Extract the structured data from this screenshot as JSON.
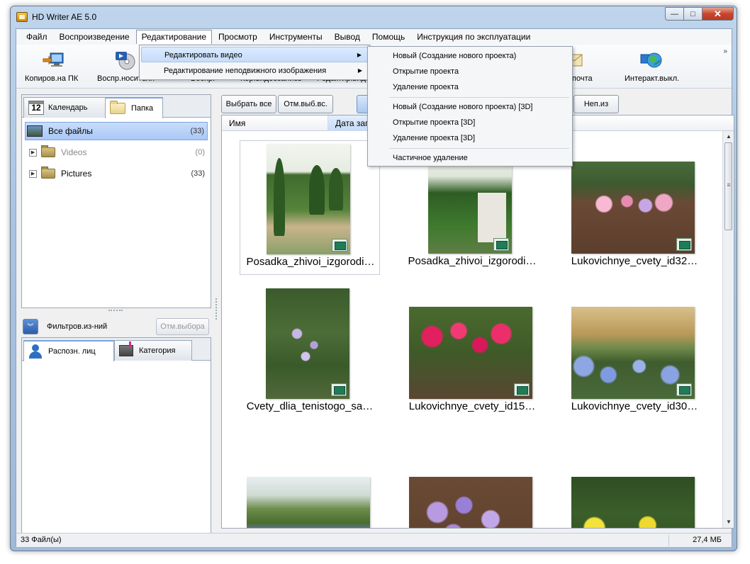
{
  "window": {
    "title": "HD Writer AE 5.0"
  },
  "window_buttons": {
    "minimize": "—",
    "maximize": "□",
    "close": "✕"
  },
  "menu": [
    {
      "label": "Файл"
    },
    {
      "label": "Воспроизведение"
    },
    {
      "label": "Редактирование"
    },
    {
      "label": "Просмотр"
    },
    {
      "label": "Инструменты"
    },
    {
      "label": "Вывод"
    },
    {
      "label": "Помощь"
    },
    {
      "label": "Инструкция по эксплуатации"
    }
  ],
  "toolbar": {
    "items": [
      {
        "label": "Копиров.на ПК",
        "icon": "copy-to-pc-icon"
      },
      {
        "label": "Воспр.носителя",
        "icon": "media-play-icon"
      },
      {
        "label": "Воспр.",
        "icon": "play-icon"
      },
      {
        "label": "Кор.видеозапись",
        "icon": "video-clip-icon"
      },
      {
        "label": "Редактир.виде",
        "icon": "video-edit-icon"
      },
      {
        "label": "почта",
        "icon": "mail-icon"
      },
      {
        "label": "Интеракт.выкл.",
        "icon": "interactive-off-icon"
      }
    ],
    "more": "»"
  },
  "edit_menu": {
    "items": [
      {
        "label": "Редактировать видео",
        "arrow": "▶"
      },
      {
        "label": "Редактирование неподвижного изображения",
        "arrow": "▶"
      }
    ]
  },
  "video_submenu": {
    "items": [
      "Новый (Создание нового проекта)",
      "Открытие проекта",
      "Удаление проекта",
      "Новый (Создание нового проекта) [3D]",
      "Открытие проекта [3D]",
      "Удаление проекта [3D]",
      "Частичное удаление"
    ]
  },
  "left_tabs": {
    "calendar": "Календарь",
    "calendar_day": "12",
    "folder": "Папка"
  },
  "tree": {
    "all_files": {
      "label": "Все файлы",
      "count": "(33)"
    },
    "videos": {
      "label": "Videos",
      "count": "(0)",
      "expander": "▶"
    },
    "pictures": {
      "label": "Pictures",
      "count": "(33)",
      "expander": "▶"
    }
  },
  "filter": {
    "toggle": "︾",
    "label": "Фильтров.из-ний",
    "clear": "Отм.выбора"
  },
  "lower_tabs": {
    "faces": "Распозн. лиц",
    "category": "Категория"
  },
  "content_toolbar": {
    "select_all": "Выбрать все",
    "deselect": "Отм.выб.вс.",
    "unselected": "Неп.из"
  },
  "columns": {
    "name": "Имя",
    "date": "Дата запи"
  },
  "thumbnails": [
    {
      "label": "Posadka_zhivoi_izgorodi…"
    },
    {
      "label": "Posadka_zhivoi_izgorodi…"
    },
    {
      "label": "Lukovichnye_cvety_id32…"
    },
    {
      "label": "Cvety_dlia_tenistogo_sa…"
    },
    {
      "label": "Lukovichnye_cvety_id15…"
    },
    {
      "label": "Lukovichnye_cvety_id30…"
    },
    {
      "label": ""
    },
    {
      "label": ""
    },
    {
      "label": ""
    }
  ],
  "scroll": {
    "up": "▲",
    "down": "▼",
    "grip": "≡"
  },
  "status": {
    "files": "33 Файл(ы)",
    "size": "27,4 МБ"
  }
}
